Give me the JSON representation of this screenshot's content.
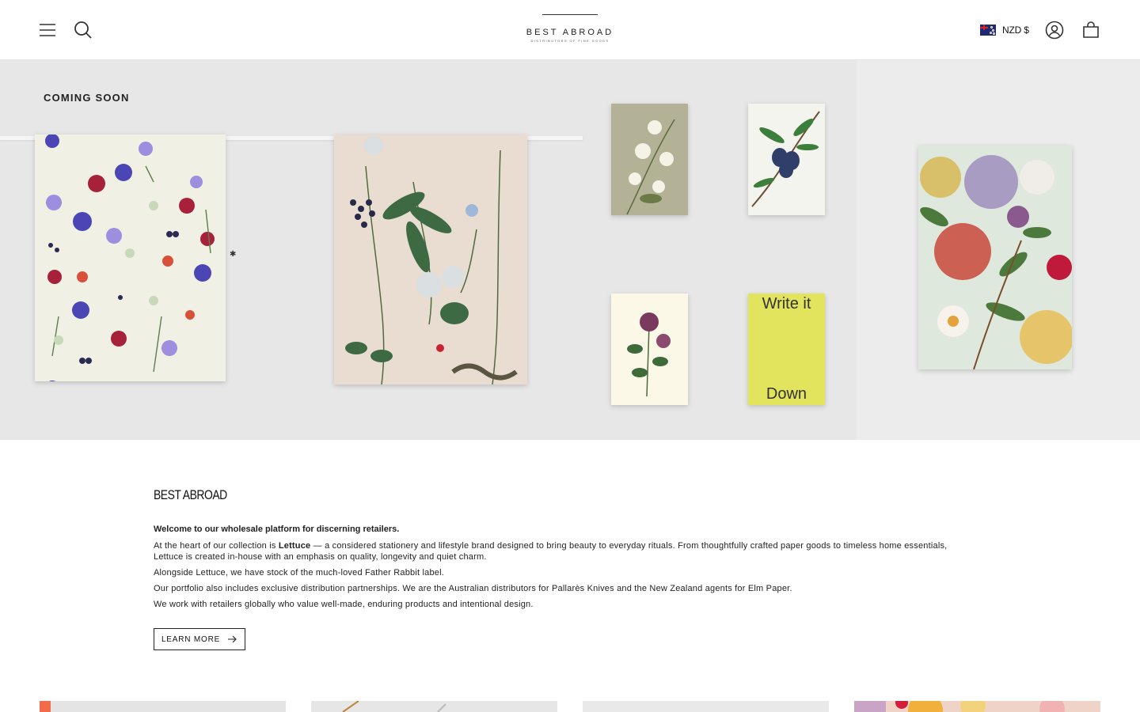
{
  "header": {
    "logo_name": "BEST ABROAD",
    "logo_tagline": "DISTRIBUTORS OF FINE GOODS",
    "currency": "NZD $",
    "icons": [
      "menu-icon",
      "search-icon",
      "nz-flag-icon",
      "account-icon",
      "cart-icon"
    ]
  },
  "hero": {
    "heading": "COMING SOON",
    "notebook_text_top": "Write it",
    "notebook_text_bottom": "Down",
    "notebook_color": "#e3e45e"
  },
  "about": {
    "title": "BEST ABROAD",
    "lead": "Welcome to our wholesale platform for discerning retailers.",
    "p1_before": "At the heart of our collection is ",
    "p1_brand": "Lettuce",
    "p1_after": " — a considered stationery and lifestyle brand designed to bring beauty to everyday rituals. From thoughtfully crafted paper goods to timeless home essentials, Lettuce is created in-house with an emphasis on quality, longevity and quiet charm.",
    "p2": "Alongside Lettuce, we have stock of the much-loved Father Rabbit label.",
    "p3": "Our portfolio also includes exclusive distribution partnerships. We are the Australian distributors for Pallarès Knives and the New Zealand agents for Elm Paper.",
    "p4": "We work with retailers globally who value well-made, enduring products and intentional design.",
    "button": "LEARN MORE"
  },
  "colors": {
    "hero_bg": "#e7e7e7",
    "text": "#111111"
  }
}
